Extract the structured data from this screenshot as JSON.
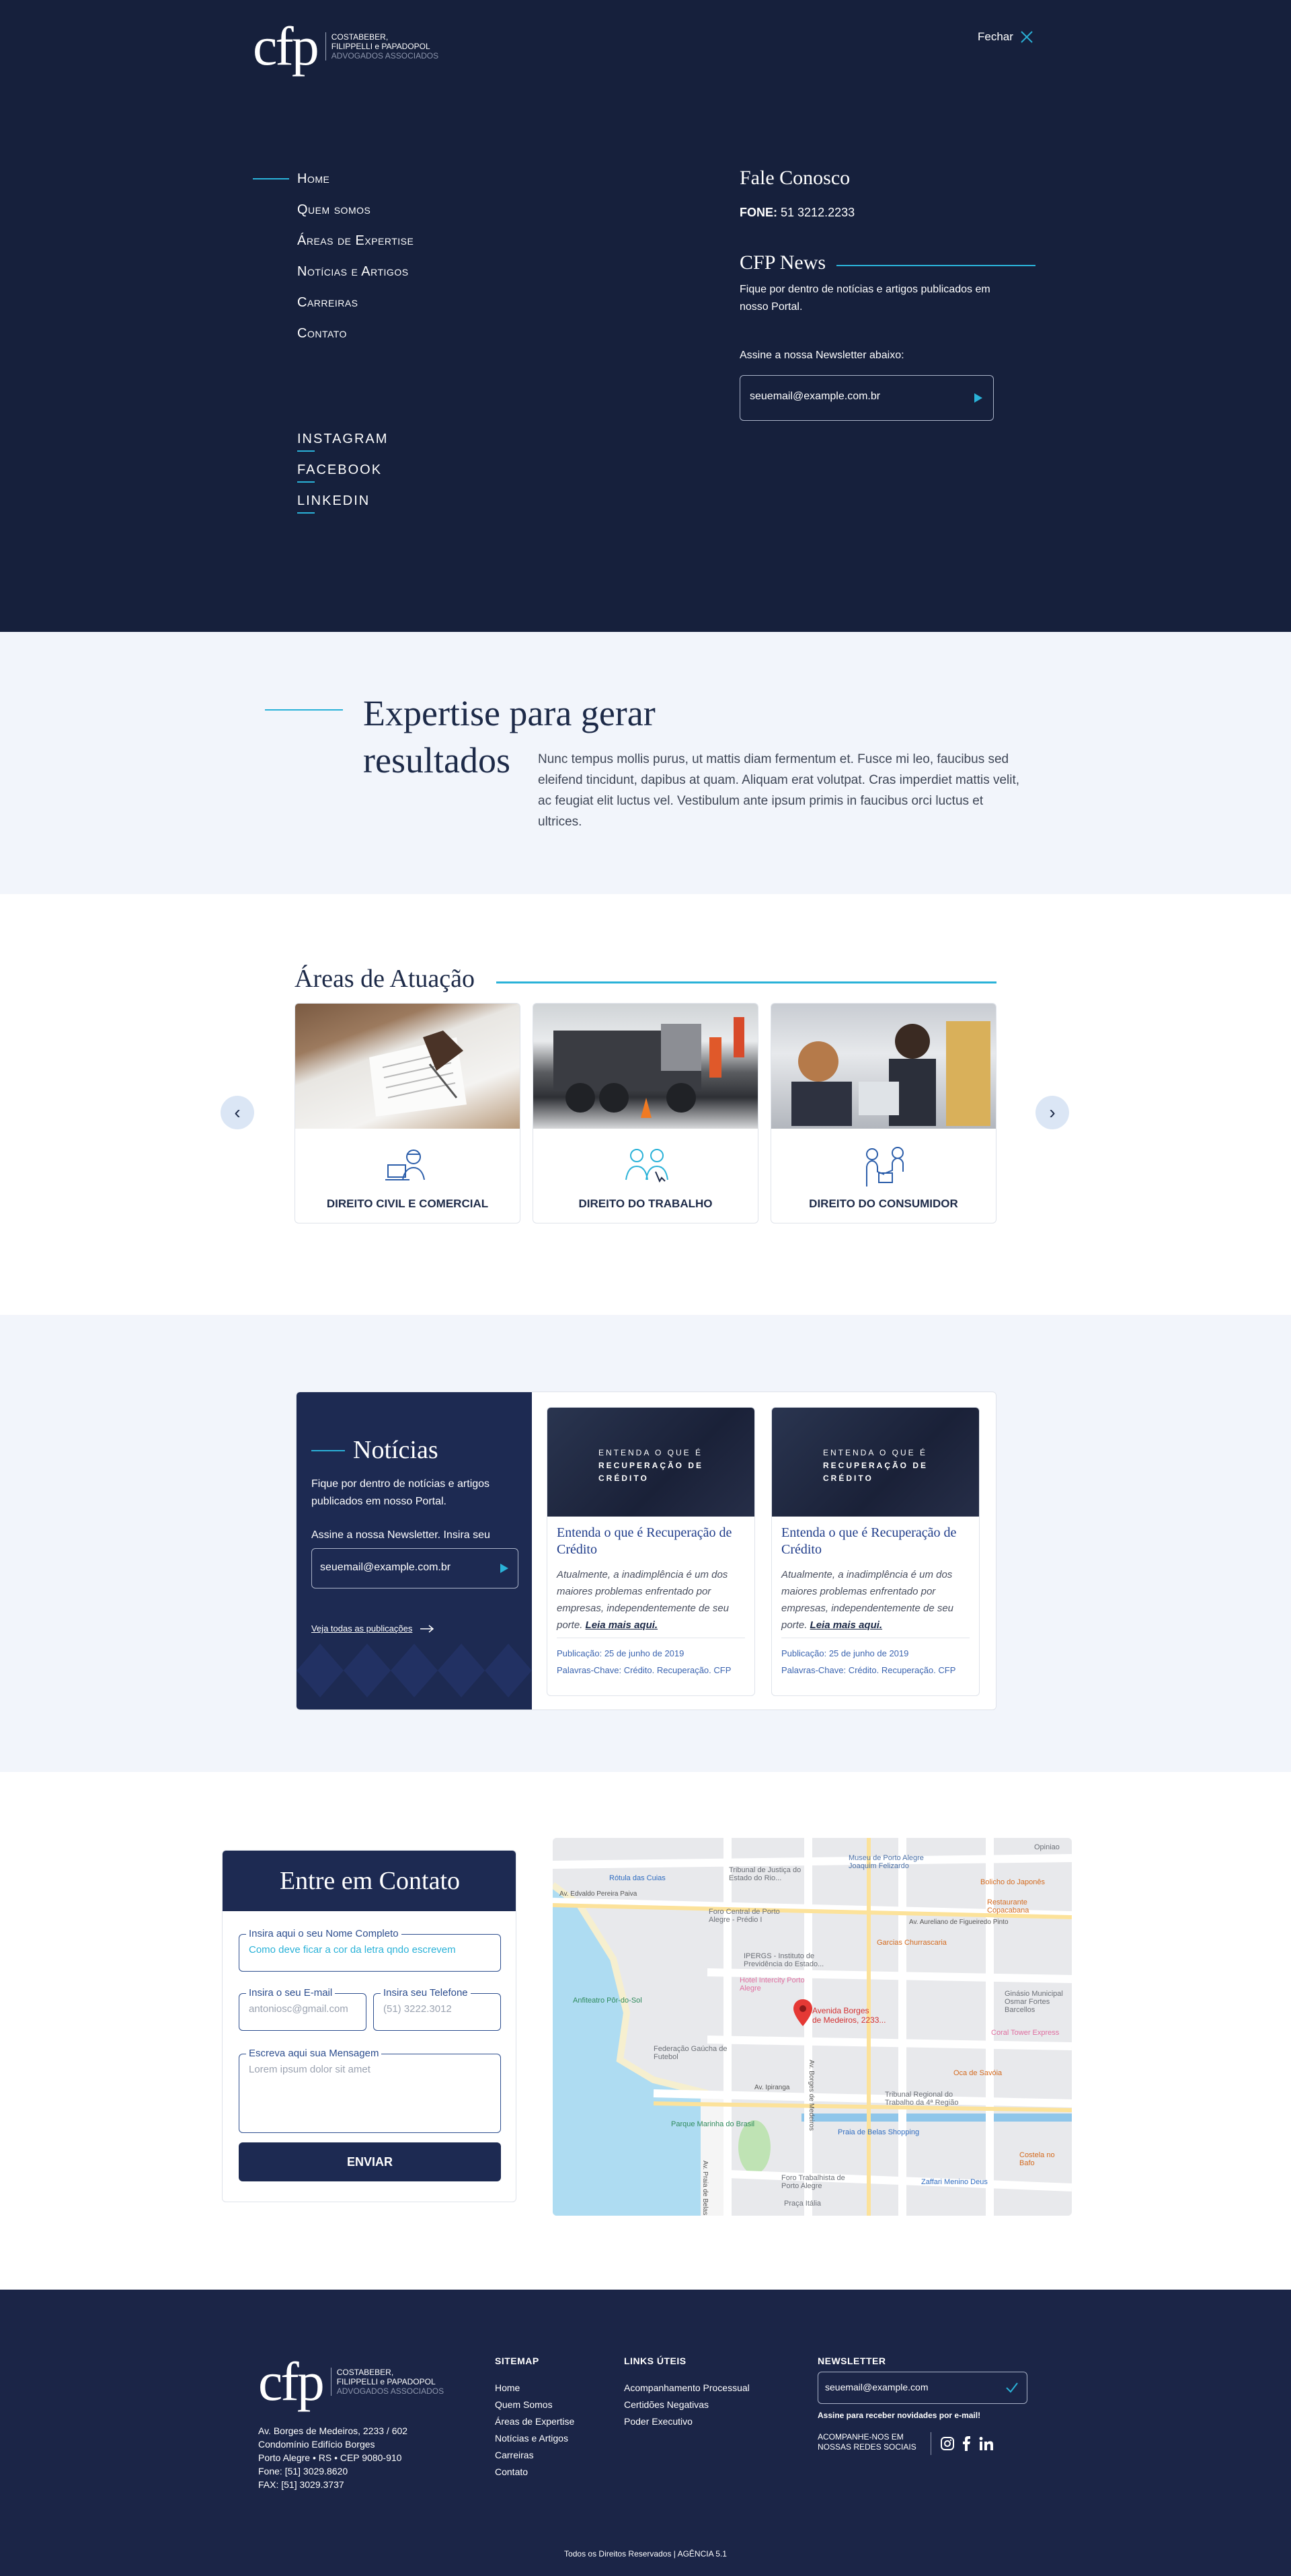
{
  "logo": {
    "mark": "cfp",
    "line1": "COSTABEBER,",
    "line2": "FILIPPELLI e PAPADOPOL",
    "line3": "ADVOGADOS ASSOCIADOS"
  },
  "menu": {
    "close_label": "Fechar",
    "nav": [
      "Home",
      "Quem somos",
      "Áreas de Expertise",
      "Notícias e Artigos",
      "Carreiras",
      "Contato"
    ],
    "social": [
      "INSTAGRAM",
      "FACEBOOK",
      "LINKEDIN"
    ],
    "fale": {
      "title": "Fale Conosco",
      "phone_label": "FONE:",
      "phone": "51 3212.2233"
    },
    "cfpnews": {
      "title": "CFP News",
      "text": "Fique por dentro de notícias e artigos publicados em nosso Portal.",
      "newsletter_label": "Assine a nossa Newsletter abaixo:",
      "email_placeholder": "seuemail@example.com.br"
    }
  },
  "expertise": {
    "title_line1": "Expertise para gerar",
    "title_line2": "resultados",
    "text": "Nunc tempus mollis purus, ut mattis diam fermentum et. Fusce mi leo, faucibus sed eleifend tincidunt, dapibus at quam. Aliquam erat volutpat. Cras imperdiet mattis velit, ac feugiat elit luctus vel. Vestibulum ante ipsum primis in faucibus orci luctus et ultrices."
  },
  "areas": {
    "title": "Áreas de Atuação",
    "cards": [
      "DIREITO CIVIL E COMERCIAL",
      "DIREITO DO TRABALHO",
      "DIREITO DO CONSUMIDOR"
    ]
  },
  "news": {
    "title": "Notícias",
    "text": "Fique por dentro de notícias e artigos publicados em nosso Portal.",
    "newsletter_label": "Assine a nossa Newsletter. Insira seu",
    "email_placeholder": "seuemail@example.com.br",
    "all_link": "Veja todas as publicações",
    "cards": [
      {
        "banner1": "ENTENDA O QUE É",
        "banner2": "RECUPERAÇÃO DE",
        "banner3": "CRÉDITO",
        "title": "Entenda o que é Recuperação de Crédito",
        "excerpt": "Atualmente, a inadimplência é um dos maiores problemas enfrentado por empresas, independentemente de seu porte.",
        "more": "Leia mais aqui.",
        "date": "Publicação: 25 de junho de 2019",
        "keywords": "Palavras-Chave: Crédito. Recuperação. CFP"
      },
      {
        "banner1": "ENTENDA O QUE É",
        "banner2": "RECUPERAÇÃO DE",
        "banner3": "CRÉDITO",
        "title": "Entenda o que é Recuperação de Crédito",
        "excerpt": "Atualmente, a inadimplência é um dos maiores problemas enfrentado por empresas, independentemente de seu porte.",
        "more": "Leia mais aqui.",
        "date": "Publicação: 25 de junho de 2019",
        "keywords": "Palavras-Chave: Crédito. Recuperação. CFP"
      }
    ]
  },
  "contact": {
    "title": "Entre em Contato",
    "name_label": "Insira aqui o seu Nome Completo",
    "name_value": "Como deve ficar a cor da letra qndo escrevem",
    "email_label": "Insira o seu E-mail",
    "email_value": "antoniosc@gmail.com",
    "phone_label": "Insira seu Telefone",
    "phone_value": "(51) 3222.3012",
    "message_label": "Escreva aqui sua Mensagem",
    "message_value": "Lorem ipsum dolor sit amet",
    "submit": "ENVIAR"
  },
  "map": {
    "pin_label1": "Avenida Borges",
    "pin_label2": "de Medeiros, 2233...",
    "places": [
      "Museu de Porto Alegre Joaquim Felizardo",
      "Tribunal de Justiça do Estado do Rio...",
      "Foro Central de Porto Alegre - Prédio I",
      "Garcias Churrascaria",
      "IPERGS - Instituto de Previdência do Estado...",
      "Hotel Intercity Porto Alegre",
      "Anfiteatro Pôr-do-Sol",
      "Federação Gaúcha de Futebol",
      "Parque Marinha do Brasil",
      "Tribunal Regional do Trabalho da 4ª Região",
      "Praia de Belas Shopping",
      "Foro Trabalhista de Porto Alegre",
      "Zaffari Menino Deus",
      "Restaurante Copacabana",
      "Bolicho do Japonês",
      "Oca de Savóia",
      "Coral Tower Express",
      "Costela no Bafo",
      "Ginásio Municipal Osmar Fortes Barcellos",
      "Rótula das Cuias",
      "Opiniao",
      "Praça Itália"
    ],
    "streets": [
      "Av. Aureliano de Figueiredo Pinto",
      "Av. Ipiranga",
      "Av. Edvaldo Pereira Paiva",
      "Av. Borges de Medeiros",
      "Av. Praia de Belas"
    ]
  },
  "footer": {
    "address": [
      "Av. Borges de Medeiros, 2233 / 602",
      "Condomínio Edifício Borges",
      "Porto Alegre • RS • CEP 9080-910",
      "Fone: [51] 3029.8620",
      "FAX: [51] 3029.3737"
    ],
    "sitemap_title": "SITEMAP",
    "sitemap": [
      "Home",
      "Quem Somos",
      "Áreas de Expertise",
      "Notícias e Artigos",
      "Carreiras",
      "Contato"
    ],
    "links_title": "LINKS ÚTEIS",
    "links": [
      "Acompanhamento Processual",
      "Certidões Negativas",
      "Poder Executivo"
    ],
    "newsletter_title": "NEWSLETTER",
    "newsletter_placeholder": "seuemail@example.com",
    "newsletter_note": "Assine para receber novidades por e-mail!",
    "social_label1": "ACOMPANHE-NOS EM",
    "social_label2": "NOSSAS REDES SOCIAIS",
    "copyright": "Todos os Direitos Reservados | AGÊNCIA 5.1"
  }
}
